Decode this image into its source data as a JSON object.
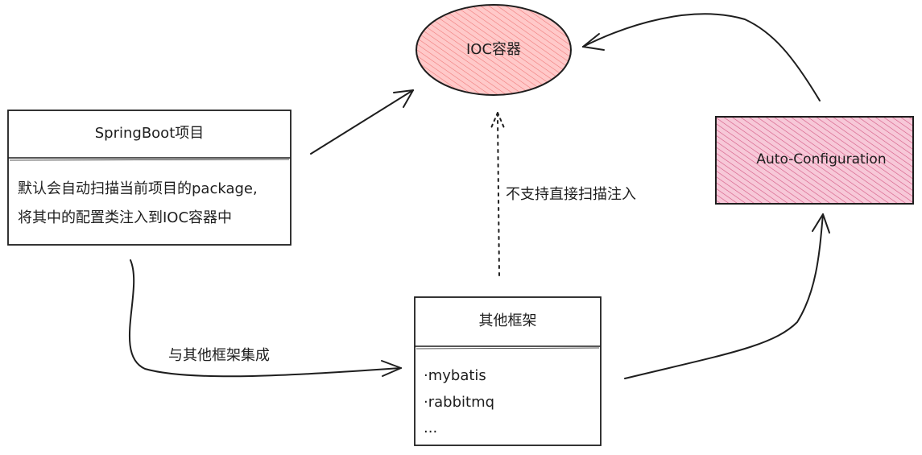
{
  "ioc": {
    "label": "IOC容器",
    "fill_color": "#ffc9c9",
    "hatch_color": "#e03131"
  },
  "springboot": {
    "title": "SpringBoot项目",
    "desc_line1": "默认会自动扫描当前项目的package,",
    "desc_line2": "将其中的配置类注入到IOC容器中"
  },
  "autoconfig": {
    "label": "Auto-Configuration",
    "fill_color": "#f7c8d8",
    "hatch_color": "#c2255c"
  },
  "frameworks": {
    "title": "其他框架",
    "items": [
      "·mybatis",
      "·rabbitmq",
      "..."
    ]
  },
  "edges": {
    "not_supported": "不支持直接扫描注入",
    "integrate": "与其他框架集成"
  },
  "stroke_color": "#1e1e1e"
}
